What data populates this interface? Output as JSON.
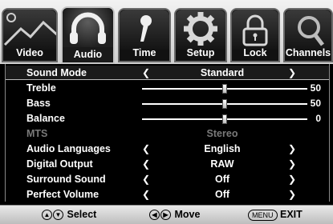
{
  "tabs": [
    {
      "label": "Video",
      "icon": "landscape-icon",
      "active": false
    },
    {
      "label": "Audio",
      "icon": "headphones-icon",
      "active": true
    },
    {
      "label": "Time",
      "icon": "pin-icon",
      "active": false
    },
    {
      "label": "Setup",
      "icon": "gear-icon",
      "active": false
    },
    {
      "label": "Lock",
      "icon": "padlock-icon",
      "active": false
    },
    {
      "label": "Channels",
      "icon": "magnifier-icon",
      "active": false
    }
  ],
  "menu": {
    "sound_mode": {
      "label": "Sound Mode",
      "value": "Standard"
    },
    "treble": {
      "label": "Treble",
      "value": "50",
      "level": 0.5
    },
    "bass": {
      "label": "Bass",
      "value": "50",
      "level": 0.5
    },
    "balance": {
      "label": "Balance",
      "value": "0",
      "level": 0.5
    },
    "mts": {
      "label": "MTS",
      "value": "Stereo"
    },
    "audio_languages": {
      "label": "Audio Languages",
      "value": "English"
    },
    "digital_output": {
      "label": "Digital Output",
      "value": "RAW"
    },
    "surround_sound": {
      "label": "Surround Sound",
      "value": "Off"
    },
    "perfect_volume": {
      "label": "Perfect Volume",
      "value": "Off"
    }
  },
  "footer": {
    "select_label": "Select",
    "move_label": "Move",
    "menu_key": "MENU",
    "exit_label": "EXIT"
  },
  "colors": {
    "accent": "#ffffff",
    "panel": "#000000",
    "tab_bar": "#dcdcdc",
    "disabled": "#7a7a7a"
  }
}
